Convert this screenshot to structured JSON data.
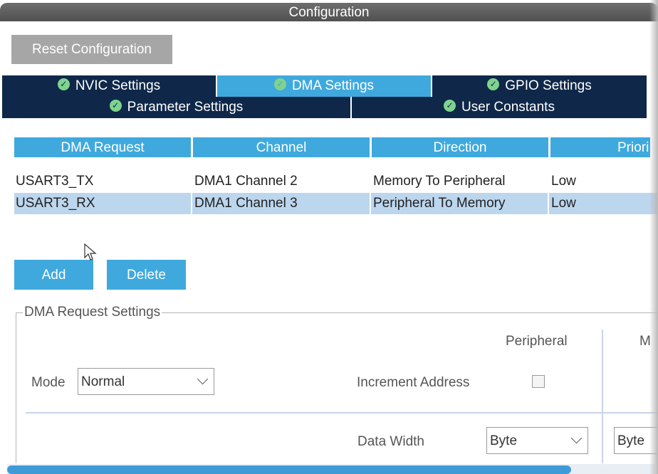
{
  "window": {
    "title": "Configuration"
  },
  "toolbar": {
    "reset_label": "Reset Configuration"
  },
  "tabs_row1": [
    {
      "label": "NVIC Settings",
      "active": false
    },
    {
      "label": "DMA Settings",
      "active": true
    },
    {
      "label": "GPIO Settings",
      "active": false
    }
  ],
  "tabs_row2": [
    {
      "label": "Parameter Settings"
    },
    {
      "label": "User Constants"
    }
  ],
  "table": {
    "headers": [
      "DMA Request",
      "Channel",
      "Direction",
      "Priori"
    ],
    "rows": [
      {
        "request": "USART3_TX",
        "channel": "DMA1 Channel 2",
        "direction": "Memory To Peripheral",
        "priority": "Low",
        "selected": false
      },
      {
        "request": "USART3_RX",
        "channel": "DMA1 Channel 3",
        "direction": "Peripheral To Memory",
        "priority": "Low",
        "selected": true
      }
    ]
  },
  "actions": {
    "add_label": "Add",
    "delete_label": "Delete"
  },
  "settings": {
    "group_title": "DMA Request Settings",
    "mode_label": "Mode",
    "mode_value": "Normal",
    "peripheral_header": "Peripheral",
    "memory_header_partial": "M",
    "increment_label": "Increment Address",
    "peripheral_increment_checked": false,
    "data_width_label": "Data Width",
    "peripheral_data_width": "Byte",
    "memory_data_width": "Byte"
  },
  "colors": {
    "accent": "#3fa9de",
    "tab_dark": "#0f2849",
    "selection": "#bcd6ee"
  },
  "icons": {
    "tab_status": "check-circle-icon",
    "dropdown": "chevron-down-icon"
  }
}
